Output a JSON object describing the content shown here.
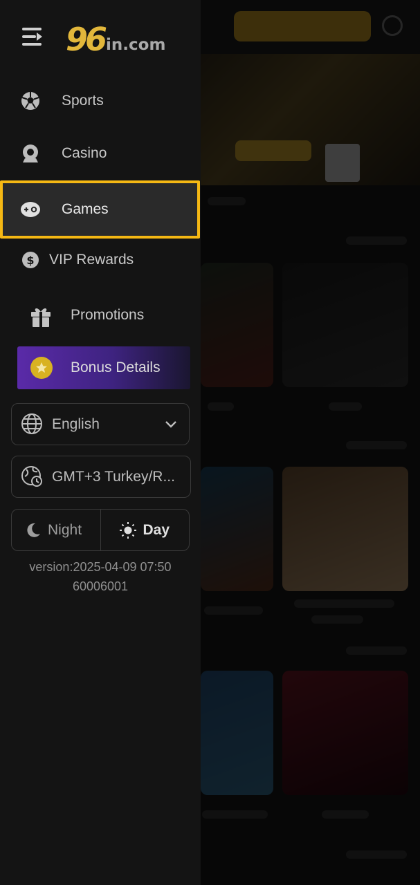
{
  "header": {
    "logo_number": "96",
    "logo_domain": "in.com"
  },
  "nav": {
    "items": [
      {
        "label": "Sports",
        "icon": "soccer-ball-icon"
      },
      {
        "label": "Casino",
        "icon": "casino-chip-icon"
      },
      {
        "label": "Games",
        "icon": "gamepad-icon",
        "selected": true
      },
      {
        "label": "VIP Rewards",
        "icon": "dollar-coin-icon"
      }
    ]
  },
  "promotions": {
    "label": "Promotions",
    "icon": "gift-icon"
  },
  "bonus": {
    "label": "Bonus Details",
    "icon": "star-coin-icon"
  },
  "language": {
    "value": "English",
    "icon": "globe-icon"
  },
  "timezone": {
    "value": "GMT+3 Turkey/R...",
    "icon": "globe-clock-icon"
  },
  "theme": {
    "night_label": "Night",
    "day_label": "Day",
    "active": "Day"
  },
  "version": {
    "line1": "version:2025-04-09 07:50",
    "line2": "60006001"
  },
  "colors": {
    "accent": "#f5b814",
    "logo_gold": "#e2b73b",
    "bonus_purple": "#5a2aa8",
    "drawer_bg": "#141414"
  }
}
